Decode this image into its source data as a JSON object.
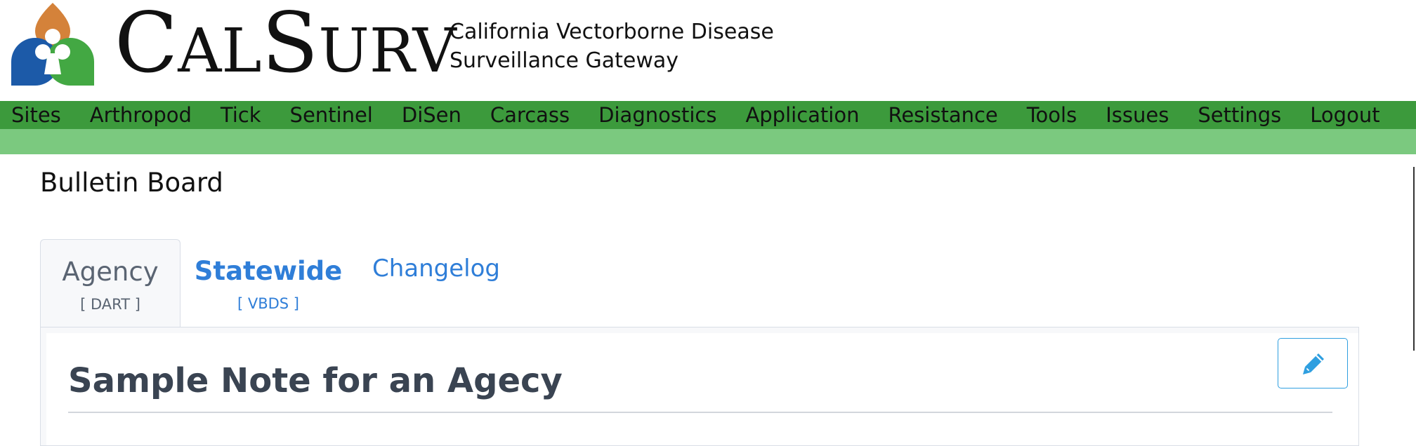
{
  "header": {
    "brand_c": "C",
    "brand_al": "AL",
    "brand_s": "S",
    "brand_urv": "URV",
    "tagline_line1": "California Vectorborne Disease",
    "tagline_line2": "Surveillance Gateway"
  },
  "nav": {
    "items": [
      {
        "label": "Sites"
      },
      {
        "label": "Arthropod"
      },
      {
        "label": "Tick"
      },
      {
        "label": "Sentinel"
      },
      {
        "label": "DiSen"
      },
      {
        "label": "Carcass"
      },
      {
        "label": "Diagnostics"
      },
      {
        "label": "Application"
      },
      {
        "label": "Resistance"
      },
      {
        "label": "Tools"
      },
      {
        "label": "Issues"
      },
      {
        "label": "Settings"
      },
      {
        "label": "Logout"
      }
    ]
  },
  "page": {
    "title": "Bulletin Board"
  },
  "tabs": {
    "agency": {
      "label": "Agency",
      "sub": "[ DART ]"
    },
    "statewide": {
      "label": "Statewide",
      "sub": "[ VBDS ]"
    },
    "changelog": {
      "label": "Changelog"
    }
  },
  "note": {
    "title": "Sample Note for an Agecy"
  },
  "icons": {
    "logo": "calsurv-trefoil-logo",
    "edit": "pencil-icon"
  },
  "colors": {
    "nav_bg": "#3c9a3c",
    "subbar_bg": "#7bc97f",
    "link_blue": "#2f7ed8",
    "edit_blue": "#2f9fe0",
    "logo_orange": "#d4823a",
    "logo_blue": "#1c5aa8",
    "logo_green": "#43a843"
  }
}
